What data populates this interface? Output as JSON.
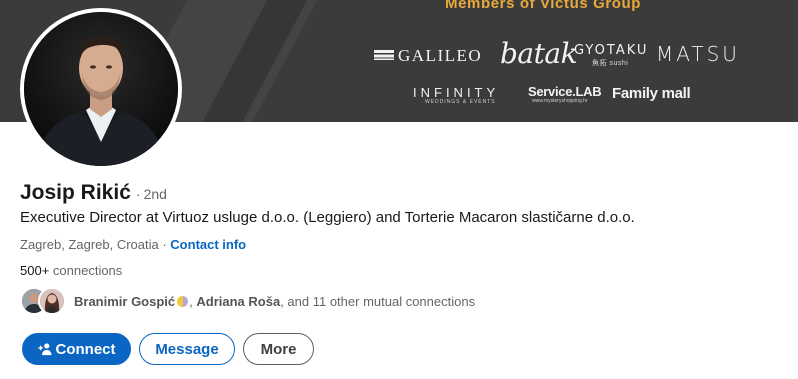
{
  "banner": {
    "heading": "Members of Victus Group",
    "logos": {
      "galileo": "GALILEO",
      "batak": "batak",
      "gyotaku": "GYOTAKU",
      "gyotaku_sub": "魚拓 sushi",
      "matsu": "MATSU",
      "infinity": "INFINITY",
      "infinity_sub": "WEDDINGS & EVENTS",
      "servicelab": "Service.LAB",
      "servicelab_sub": "www.mysteryshopping.hr",
      "familymall": "Family mall"
    }
  },
  "profile": {
    "name": "Josip Rikić",
    "degree_separator": "·",
    "degree": "2nd",
    "headline": "Executive Director at Virtuoz usluge d.o.o. (Leggiero) and Torterie Macaron slastičarne d.o.o.",
    "location": "Zagreb, Zagreb, Croatia",
    "location_separator": " · ",
    "contact_info": "Contact info",
    "connections_count": "500+",
    "connections_label": " connections"
  },
  "mutual": {
    "person1": "Branimir Gospić",
    "separator": ", ",
    "person2": "Adriana Roša",
    "rest": ", and 11 other mutual connections"
  },
  "actions": {
    "connect": "Connect",
    "message": "Message",
    "more": "More"
  },
  "colors": {
    "accent": "#0a66c2",
    "banner_bg": "#3b3b3b",
    "banner_heading": "#e8a93a"
  }
}
